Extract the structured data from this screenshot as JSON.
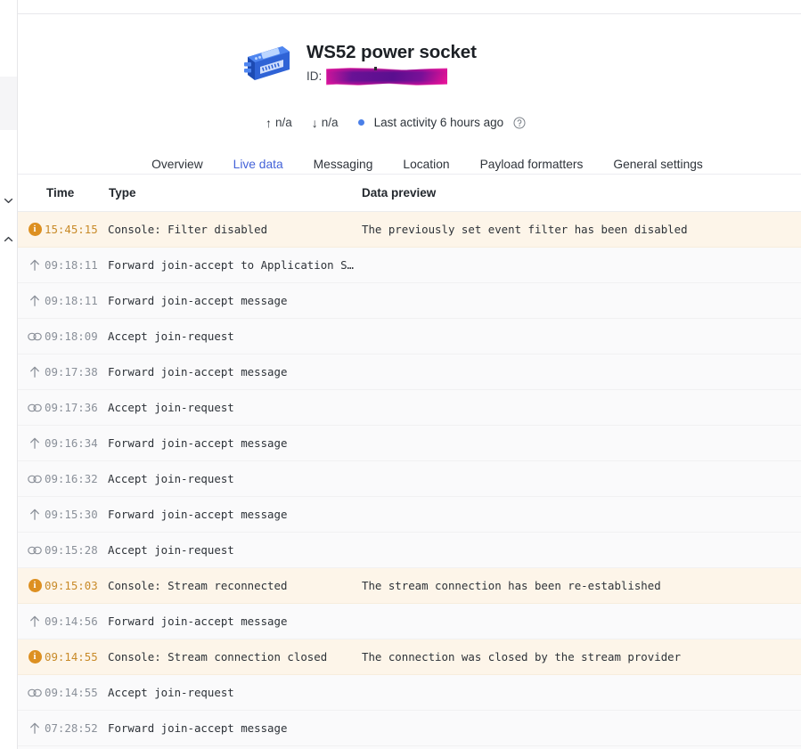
{
  "device": {
    "icon_name": "gateway-device-icon",
    "name": "WS52 power socket",
    "id_label": "ID:",
    "id_value_redacted": "",
    "uplink": {
      "icon": "arrow-up-icon",
      "glyph": "↑",
      "value": "n/a"
    },
    "downlink": {
      "icon": "arrow-down-icon",
      "glyph": "↓",
      "value": "n/a"
    },
    "activity": "Last activity 6 hours ago",
    "help_icon": "help-circle-icon",
    "status_color": "#4a7fe8"
  },
  "tabs": [
    {
      "label": "Overview",
      "active": false
    },
    {
      "label": "Live data",
      "active": true
    },
    {
      "label": "Messaging",
      "active": false
    },
    {
      "label": "Location",
      "active": false
    },
    {
      "label": "Payload formatters",
      "active": false
    },
    {
      "label": "General settings",
      "active": false
    }
  ],
  "tab_accent_color": "#4362d8",
  "table": {
    "columns": [
      "Time",
      "Type",
      "Data preview"
    ],
    "rows": [
      {
        "icon": "info-circle-icon",
        "kind": "console",
        "time": "15:45:15",
        "type": "Console: Filter disabled",
        "data": "The previously set event filter has been disabled"
      },
      {
        "icon": "arrow-up-icon",
        "kind": "uplink",
        "time": "09:18:11",
        "type": "Forward join-accept to Application S…",
        "data": ""
      },
      {
        "icon": "arrow-up-icon",
        "kind": "uplink",
        "time": "09:18:11",
        "type": "Forward join-accept message",
        "data": ""
      },
      {
        "icon": "link-icon",
        "kind": "join",
        "time": "09:18:09",
        "type": "Accept join-request",
        "data": ""
      },
      {
        "icon": "arrow-up-icon",
        "kind": "uplink",
        "time": "09:17:38",
        "type": "Forward join-accept message",
        "data": ""
      },
      {
        "icon": "link-icon",
        "kind": "join",
        "time": "09:17:36",
        "type": "Accept join-request",
        "data": ""
      },
      {
        "icon": "arrow-up-icon",
        "kind": "uplink",
        "time": "09:16:34",
        "type": "Forward join-accept message",
        "data": ""
      },
      {
        "icon": "link-icon",
        "kind": "join",
        "time": "09:16:32",
        "type": "Accept join-request",
        "data": ""
      },
      {
        "icon": "arrow-up-icon",
        "kind": "uplink",
        "time": "09:15:30",
        "type": "Forward join-accept message",
        "data": ""
      },
      {
        "icon": "link-icon",
        "kind": "join",
        "time": "09:15:28",
        "type": "Accept join-request",
        "data": ""
      },
      {
        "icon": "info-circle-icon",
        "kind": "console",
        "time": "09:15:03",
        "type": "Console: Stream reconnected",
        "data": "The stream connection has been re-established"
      },
      {
        "icon": "arrow-up-icon",
        "kind": "uplink",
        "time": "09:14:56",
        "type": "Forward join-accept message",
        "data": ""
      },
      {
        "icon": "info-circle-icon",
        "kind": "console",
        "time": "09:14:55",
        "type": "Console: Stream connection closed",
        "data": "The connection was closed by the stream provider"
      },
      {
        "icon": "link-icon",
        "kind": "join",
        "time": "09:14:55",
        "type": "Accept join-request",
        "data": ""
      },
      {
        "icon": "arrow-up-icon",
        "kind": "uplink",
        "time": "07:28:52",
        "type": "Forward join-accept message",
        "data": ""
      }
    ]
  },
  "left_rail": {
    "collapse_down_icon": "chevron-down-icon",
    "collapse_up_icon": "chevron-up-icon"
  }
}
